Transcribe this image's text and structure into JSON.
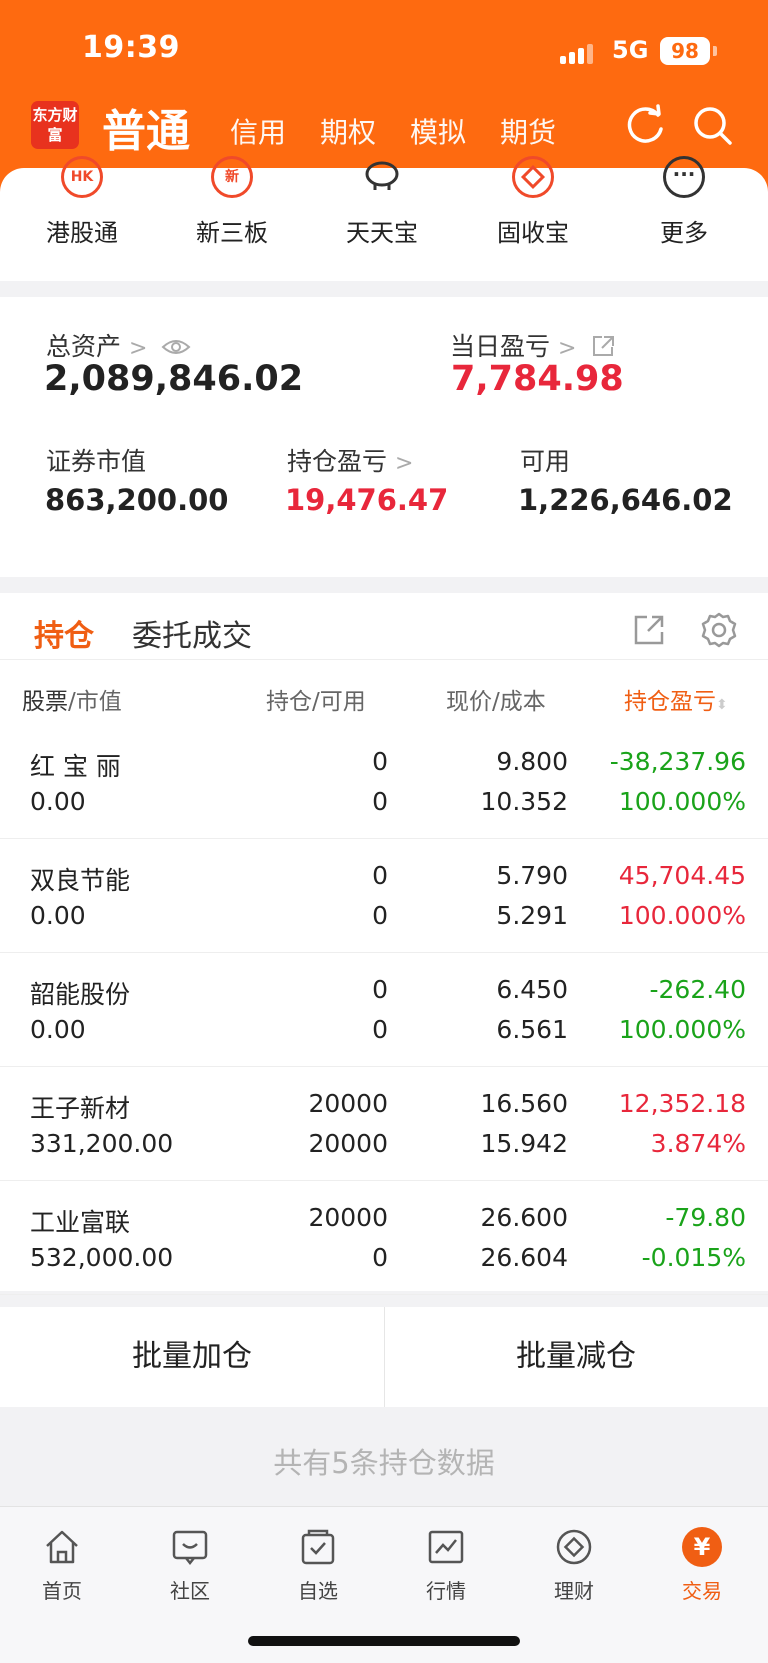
{
  "status_bar": {
    "time": "19:39",
    "network": "5G",
    "battery": "98"
  },
  "header": {
    "logo": "东方财富",
    "tabs": [
      {
        "label": "普通",
        "active": true
      },
      {
        "label": "信用"
      },
      {
        "label": "期权"
      },
      {
        "label": "模拟"
      },
      {
        "label": "期货"
      }
    ]
  },
  "quick_menu": [
    {
      "label": "港股通",
      "icon": "hk-icon",
      "glyph": "HK"
    },
    {
      "label": "新三板",
      "icon": "new-board-icon",
      "glyph": "新"
    },
    {
      "label": "天天宝",
      "icon": "piggy-bank-icon",
      "glyph": ""
    },
    {
      "label": "固收宝",
      "icon": "fixed-income-icon",
      "glyph": ""
    },
    {
      "label": "更多",
      "icon": "more-icon",
      "glyph": "···"
    }
  ],
  "assets": {
    "total_label": "总资产",
    "total_value": "2,089,846.02",
    "daily_pnl_label": "当日盈亏",
    "daily_pnl_value": "7,784.98",
    "market_value_label": "证券市值",
    "market_value": "863,200.00",
    "position_pnl_label": "持仓盈亏",
    "position_pnl": "19,476.47",
    "available_label": "可用",
    "available": "1,226,646.02"
  },
  "holdings": {
    "tab_positions": "持仓",
    "tab_orders": "委托成交",
    "columns": {
      "stock": "股票",
      "market_value": "市值",
      "holding": "持仓",
      "available": "可用",
      "price": "现价",
      "cost": "成本",
      "pnl": "持仓盈亏"
    },
    "rows": [
      {
        "name": "红 宝 丽",
        "market_value": "0.00",
        "holding": "0",
        "available": "0",
        "price": "9.800",
        "cost": "10.352",
        "pnl": "-38,237.96",
        "pnl_pct": "100.000%",
        "color": "green"
      },
      {
        "name": "双良节能",
        "market_value": "0.00",
        "holding": "0",
        "available": "0",
        "price": "5.790",
        "cost": "5.291",
        "pnl": "45,704.45",
        "pnl_pct": "100.000%",
        "color": "red"
      },
      {
        "name": "韶能股份",
        "market_value": "0.00",
        "holding": "0",
        "available": "0",
        "price": "6.450",
        "cost": "6.561",
        "pnl": "-262.40",
        "pnl_pct": "100.000%",
        "color": "green"
      },
      {
        "name": "王子新材",
        "market_value": "331,200.00",
        "holding": "20000",
        "available": "20000",
        "price": "16.560",
        "cost": "15.942",
        "pnl": "12,352.18",
        "pnl_pct": "3.874%",
        "color": "red"
      },
      {
        "name": "工业富联",
        "market_value": "532,000.00",
        "holding": "20000",
        "available": "0",
        "price": "26.600",
        "cost": "26.604",
        "pnl": "-79.80",
        "pnl_pct": "-0.015%",
        "color": "green"
      }
    ]
  },
  "batch": {
    "add": "批量加仓",
    "reduce": "批量减仓"
  },
  "footer_note": "共有5条持仓数据",
  "bottom_nav": [
    {
      "label": "首页",
      "icon": "home-icon"
    },
    {
      "label": "社区",
      "icon": "community-icon"
    },
    {
      "label": "自选",
      "icon": "watchlist-icon"
    },
    {
      "label": "行情",
      "icon": "market-icon"
    },
    {
      "label": "理财",
      "icon": "wealth-icon"
    },
    {
      "label": "交易",
      "icon": "trade-icon",
      "active": true,
      "glyph": "¥"
    }
  ],
  "colors": {
    "brand": "#fe6a10",
    "up": "#e8273b",
    "down": "#1aa31a",
    "accent": "#f05e13"
  }
}
